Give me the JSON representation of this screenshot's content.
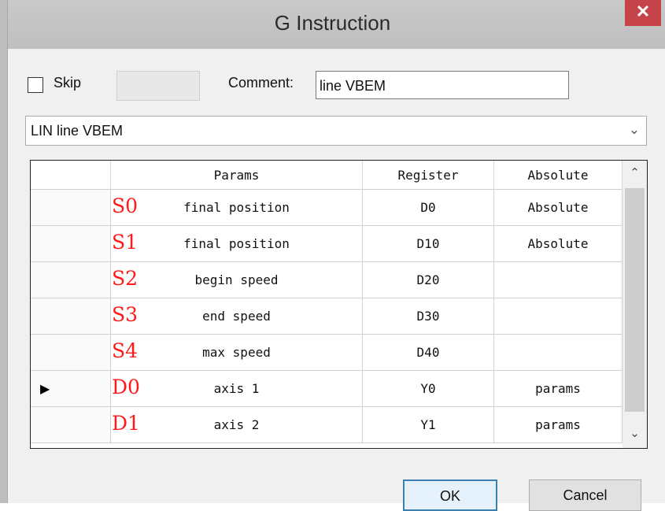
{
  "window": {
    "title": "G Instruction",
    "close_glyph": "✕"
  },
  "options": {
    "skip_label": "Skip",
    "skip_checked": false,
    "skip_value": "",
    "comment_label": "Comment:",
    "comment_value": "line VBEM"
  },
  "instruction_select": {
    "value": "LIN line VBEM",
    "arrow_glyph": "⌄"
  },
  "grid": {
    "columns": [
      "Params",
      "Register",
      "Absolute"
    ],
    "current_row_glyph": "▶",
    "rows": [
      {
        "tag": "S0",
        "param": "final position",
        "register": "D0",
        "absolute": "Absolute",
        "current": false
      },
      {
        "tag": "S1",
        "param": "final position",
        "register": "D10",
        "absolute": "Absolute",
        "current": false
      },
      {
        "tag": "S2",
        "param": "begin speed",
        "register": "D20",
        "absolute": "",
        "current": false
      },
      {
        "tag": "S3",
        "param": "end speed",
        "register": "D30",
        "absolute": "",
        "current": false
      },
      {
        "tag": "S4",
        "param": "max speed",
        "register": "D40",
        "absolute": "",
        "current": false
      },
      {
        "tag": "D0",
        "param": "axis 1",
        "register": "Y0",
        "absolute": "params",
        "current": true
      },
      {
        "tag": "D1",
        "param": "axis 2",
        "register": "Y1",
        "absolute": "params",
        "current": false
      }
    ],
    "scroll_up_glyph": "⌃",
    "scroll_down_glyph": "⌄"
  },
  "buttons": {
    "ok_label": "OK",
    "cancel_label": "Cancel"
  },
  "colors": {
    "param_tag": "#ff1a1a",
    "close_button": "#c7434a",
    "ok_border": "#3c7fb1"
  }
}
